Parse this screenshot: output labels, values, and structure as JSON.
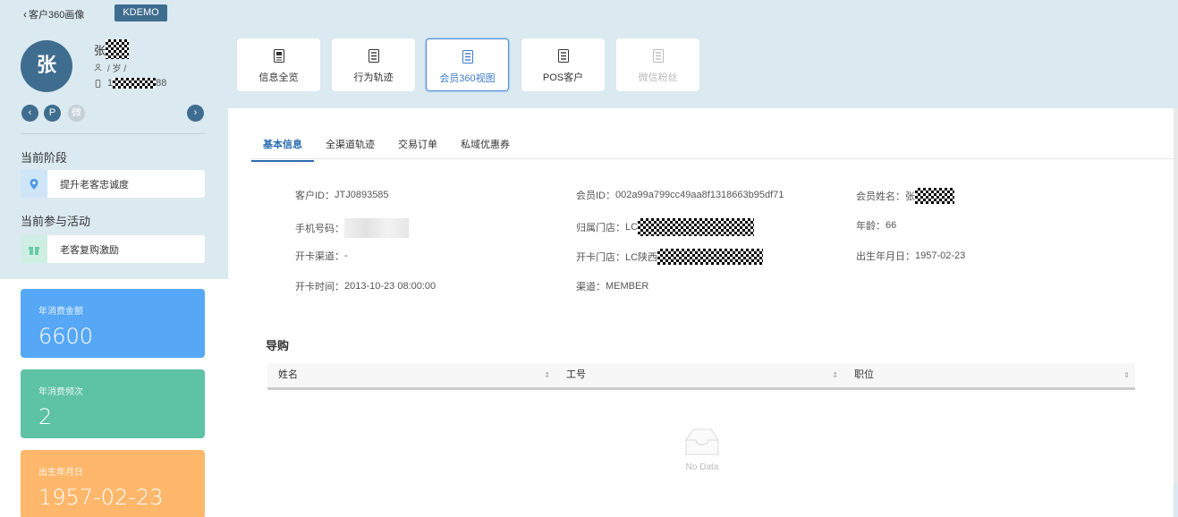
{
  "topbar": {
    "back_label": "客户360画像",
    "env_badge": "KDEMO"
  },
  "profile": {
    "avatar_char": "张",
    "name_prefix": "张",
    "gender_age": "/ 岁 /",
    "phone_prefix": "1",
    "phone_suffix": "88",
    "nav_p": "P",
    "nav_wechat": "微"
  },
  "stage": {
    "title": "当前阶段",
    "value": "提升老客忠诚度"
  },
  "activity": {
    "title": "当前参与活动",
    "value": "老客复购激励"
  },
  "stats": [
    {
      "label": "年消费金额",
      "value": "6600",
      "color": "#57a7f7"
    },
    {
      "label": "年消费频次",
      "value": "2",
      "color": "#5ec2a4"
    },
    {
      "label": "出生年月日",
      "value": "1957-02-23",
      "color": "#ffb76b"
    }
  ],
  "view_tabs": [
    {
      "label": "信息全览",
      "icon": "overview-icon"
    },
    {
      "label": "行为轨迹",
      "icon": "behavior-icon"
    },
    {
      "label": "会员360视图",
      "icon": "member-view-icon"
    },
    {
      "label": "POS客户",
      "icon": "pos-icon"
    },
    {
      "label": "微信粉丝",
      "icon": "wechat-icon"
    }
  ],
  "sub_tabs": [
    "基本信息",
    "全渠道轨迹",
    "交易订单",
    "私域优惠券"
  ],
  "fields": {
    "customer_id": {
      "label": "客户ID：",
      "value": "JTJ0893585"
    },
    "member_id": {
      "label": "会员ID：",
      "value": "002a99a799cc49aa8f1318663b95df71"
    },
    "member_name": {
      "label": "会员姓名：",
      "value": "张"
    },
    "phone": {
      "label": "手机号码：",
      "value": ""
    },
    "home_store": {
      "label": "归属门店：",
      "value": "LC"
    },
    "age": {
      "label": "年龄：",
      "value": "66"
    },
    "card_channel": {
      "label": "开卡渠道：",
      "value": "-"
    },
    "card_store": {
      "label": "开卡门店：",
      "value": "LC陕西"
    },
    "birthday": {
      "label": "出生年月日：",
      "value": "1957-02-23"
    },
    "card_time": {
      "label": "开卡时间：",
      "value": "2013-10-23 08:00:00"
    },
    "channel": {
      "label": "渠道：",
      "value": "MEMBER"
    }
  },
  "guide": {
    "title": "导购",
    "columns": [
      "姓名",
      "工号",
      "职位"
    ],
    "empty_text": "No Data"
  }
}
